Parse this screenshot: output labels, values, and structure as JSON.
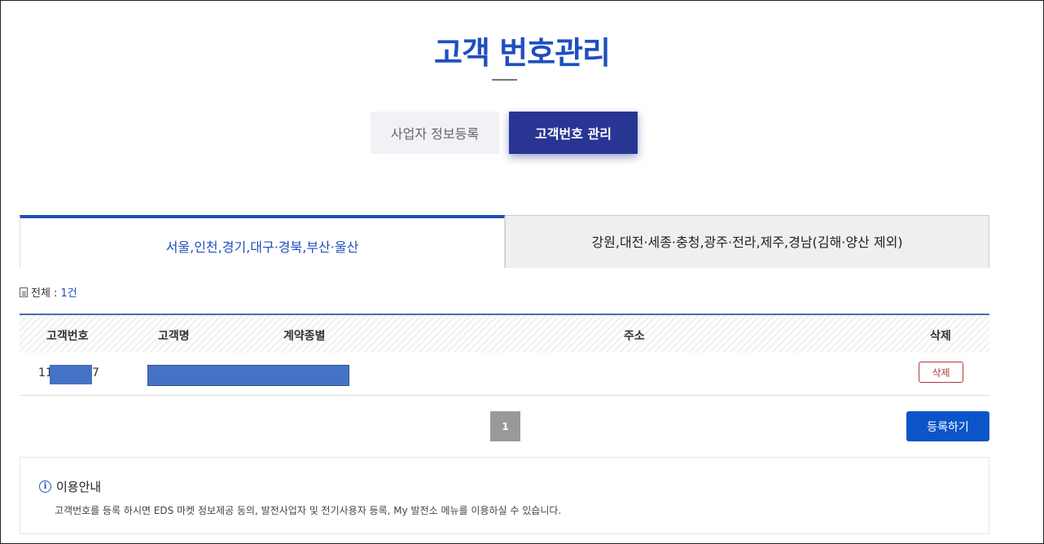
{
  "page": {
    "title": "고객 번호관리"
  },
  "top_tabs": [
    {
      "label": "사업자 정보등록",
      "active": false
    },
    {
      "label": "고객번호 관리",
      "active": true
    }
  ],
  "region_tabs": [
    {
      "label": "서울,인천,경기,대구·경북,부산·울산",
      "active": true
    },
    {
      "label": "강원,대전·세종·충청,광주·전라,제주,경남(김해·양산 제외)",
      "active": false
    }
  ],
  "count": {
    "prefix": "전체 : ",
    "value": "1건"
  },
  "table": {
    "headers": {
      "customer_no": "고객번호",
      "customer_name": "고객명",
      "contract_type": "계약종별",
      "address": "주소",
      "delete": "삭제"
    },
    "rows": [
      {
        "customer_no_start": "11",
        "customer_no_end": "7",
        "delete_label": "삭제"
      }
    ]
  },
  "pagination": {
    "current": "1"
  },
  "register_button": "등록하기",
  "notice": {
    "title": "이용안내",
    "text": "고객번호를 등록 하시면 EDS 마켓 정보제공 동의, 발전사업자 및 전기사용자 등록, My 발전소 메뉴를 이용하실 수 있습니다."
  },
  "colors": {
    "accent": "#1f4fbf",
    "active_tab": "#283593",
    "register": "#0b55c9",
    "delete": "#b33a3a",
    "redaction": "#4472c4"
  }
}
